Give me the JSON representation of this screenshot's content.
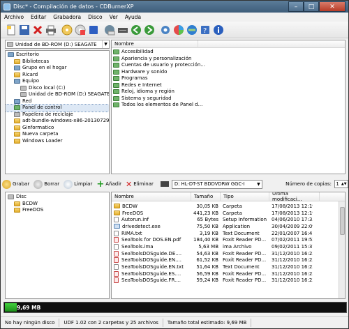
{
  "window": {
    "title": "Disc* - Compilación de datos - CDBurnerXP"
  },
  "menu": [
    "Archivo",
    "Editar",
    "Grabadora",
    "Disco",
    "Ver",
    "Ayuda"
  ],
  "drive_combo": "Unidad de BD-ROM (D:) SEAGATE",
  "tree": [
    {
      "label": "Escritorio",
      "icon": "desktop",
      "indent": 0,
      "selected": false
    },
    {
      "label": "Bibliotecas",
      "icon": "library",
      "indent": 1,
      "selected": false
    },
    {
      "label": "Grupo en el hogar",
      "icon": "homegroup",
      "indent": 1,
      "selected": false
    },
    {
      "label": "Ricard",
      "icon": "user-folder",
      "indent": 1,
      "selected": false
    },
    {
      "label": "Equipo",
      "icon": "computer",
      "indent": 1,
      "selected": false
    },
    {
      "label": "Disco local (C:)",
      "icon": "drive",
      "indent": 2,
      "selected": false
    },
    {
      "label": "Unidad de BD-ROM (D:) SEAGATE",
      "icon": "drive",
      "indent": 2,
      "selected": false
    },
    {
      "label": "Red",
      "icon": "network",
      "indent": 1,
      "selected": false
    },
    {
      "label": "Panel de control",
      "icon": "control-panel",
      "indent": 1,
      "selected": true
    },
    {
      "label": "Papelera de reciclaje",
      "icon": "recycle-bin",
      "indent": 1,
      "selected": false
    },
    {
      "label": "adt-bundle-windows-x86-20130729",
      "icon": "folder",
      "indent": 1,
      "selected": false
    },
    {
      "label": "Ginformatico",
      "icon": "folder",
      "indent": 1,
      "selected": false
    },
    {
      "label": "Nueva carpeta",
      "icon": "folder",
      "indent": 1,
      "selected": false
    },
    {
      "label": "Windows Loader",
      "icon": "folder",
      "indent": 1,
      "selected": false
    }
  ],
  "right_list": {
    "header": "Nombre",
    "items": [
      "Accesibilidad",
      "Apariencia y personalización",
      "Cuentas de usuario y protección...",
      "Hardware y sonido",
      "Programas",
      "Redes e Internet",
      "Reloj, idioma y región",
      "Sistema y seguridad",
      "Todos los elementos de Panel d..."
    ]
  },
  "toolbar2": {
    "burn": "Grabar",
    "erase": "Borrar",
    "clean": "Limpiar",
    "add": "Añadir",
    "remove": "Eliminar",
    "device": "D: HL-DT-ST BDDVDRW GGC-I",
    "copies_label": "Número de copias:",
    "copies": "1"
  },
  "disc_tree": [
    {
      "label": "Disc",
      "indent": 0
    },
    {
      "label": "BCDW",
      "indent": 1
    },
    {
      "label": "FreeDOS",
      "indent": 1
    }
  ],
  "file_table": {
    "columns": [
      "Nombre",
      "Tamaño",
      "Tipo",
      "Última modificaci..."
    ],
    "rows": [
      {
        "name": "BCDW",
        "size": "30,05 KB",
        "type": "Carpeta",
        "date": "17/08/2013 12:19",
        "icon": "folder"
      },
      {
        "name": "FreeDOS",
        "size": "441,23 KB",
        "type": "Carpeta",
        "date": "17/08/2013 12:19",
        "icon": "folder"
      },
      {
        "name": "Autorun.inf",
        "size": "65 Bytes",
        "type": "Setup Information",
        "date": "04/06/2010 17:35",
        "icon": "doc"
      },
      {
        "name": "drivedetect.exe",
        "size": "75,50 KB",
        "type": "Application",
        "date": "30/04/2009 22:09",
        "icon": "exe"
      },
      {
        "name": "RIMA.txt",
        "size": "3,19 KB",
        "type": "Text Document",
        "date": "22/01/2007 16:41",
        "icon": "doc"
      },
      {
        "name": "SeaTools for DOS.EN.pdf",
        "size": "184,40 KB",
        "type": "Foxit Reader PD...",
        "date": "07/02/2011 19:52",
        "icon": "pdf"
      },
      {
        "name": "SeaTools.ima",
        "size": "5,63 MB",
        "type": "ima Archivo",
        "date": "09/02/2011 15:37",
        "icon": "doc"
      },
      {
        "name": "SeaToolsDOSguide.DE....",
        "size": "54,63 KB",
        "type": "Foxit Reader PD...",
        "date": "31/12/2010 16:23",
        "icon": "pdf"
      },
      {
        "name": "SeaToolsDOSguide.EN....",
        "size": "61,52 KB",
        "type": "Foxit Reader PD...",
        "date": "31/12/2010 16:23",
        "icon": "pdf"
      },
      {
        "name": "SeaToolsDOSguide.EN.txt",
        "size": "51,64 KB",
        "type": "Text Document",
        "date": "31/12/2010 16:23",
        "icon": "doc"
      },
      {
        "name": "SeaToolsDOSguide.ES....",
        "size": "56,59 KB",
        "type": "Foxit Reader PD...",
        "date": "31/12/2010 16:23",
        "icon": "pdf"
      },
      {
        "name": "SeaToolsDOSguide.FR....",
        "size": "59,24 KB",
        "type": "Foxit Reader PD...",
        "date": "31/12/2010 16:23",
        "icon": "pdf"
      }
    ]
  },
  "progress": {
    "label": "9,69 MB",
    "fraction": 0.035,
    "color": "#2bb22a"
  },
  "status": [
    "No hay ningún disco",
    "UDF 1.02 con 2 carpetas y 25 archivos",
    "Tamaño total estimado: 9,69 MB"
  ],
  "colors": {
    "titlebar": "#4a6a88",
    "selection": "#dde8f5"
  }
}
